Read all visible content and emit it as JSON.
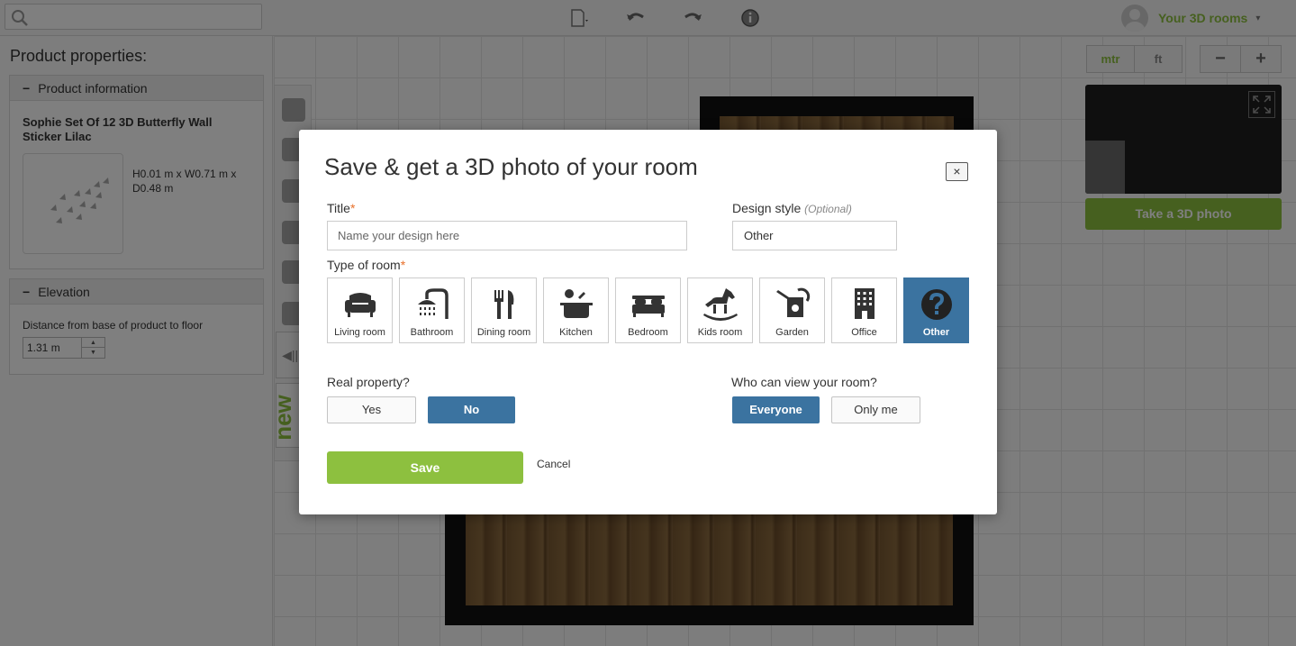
{
  "topbar": {
    "search_placeholder": "",
    "user_name": "Your 3D rooms",
    "user_caret": "▾"
  },
  "left_panel": {
    "title": "Product properties:",
    "product_info": {
      "header": "Product information",
      "toggle": "−",
      "name": "Sophie Set Of 12 3D Butterfly Wall Sticker Lilac",
      "dimensions": "H0.01 m x W0.71 m x D0.48 m"
    },
    "elevation": {
      "header": "Elevation",
      "toggle": "−",
      "label": "Distance from base of product to floor",
      "value": "1.31 m",
      "spin_up": "▲",
      "spin_down": "▼"
    }
  },
  "canvas": {
    "new_badge": "new",
    "grip": "◀|||"
  },
  "right_widgets": {
    "unit_metric": "mtr",
    "unit_imperial": "ft",
    "zoom_out": "−",
    "zoom_in": "+",
    "take_photo": "Take a 3D photo"
  },
  "modal": {
    "title": "Save & get a 3D photo of your room",
    "close": "×",
    "title_label": "Title",
    "required_mark": "*",
    "title_placeholder": "Name your design here",
    "style_label": "Design style",
    "style_optional": "(Optional)",
    "style_value": "Other",
    "room_type_label": "Type of room",
    "room_types": [
      {
        "label": "Living room",
        "icon": "armchair-icon"
      },
      {
        "label": "Bathroom",
        "icon": "shower-icon"
      },
      {
        "label": "Dining room",
        "icon": "fork-knife-icon"
      },
      {
        "label": "Kitchen",
        "icon": "pot-icon"
      },
      {
        "label": "Bedroom",
        "icon": "bed-icon"
      },
      {
        "label": "Kids room",
        "icon": "rocking-horse-icon"
      },
      {
        "label": "Garden",
        "icon": "watering-can-icon"
      },
      {
        "label": "Office",
        "icon": "building-icon"
      },
      {
        "label": "Other",
        "icon": "question-icon",
        "selected": true
      }
    ],
    "real_property_label": "Real property?",
    "yes": "Yes",
    "no": "No",
    "who_view_label": "Who can view your room?",
    "everyone": "Everyone",
    "only_me": "Only me",
    "save": "Save",
    "cancel": "Cancel"
  },
  "colors": {
    "accent_green": "#8dc03f",
    "selected_blue": "#3b73a0"
  }
}
